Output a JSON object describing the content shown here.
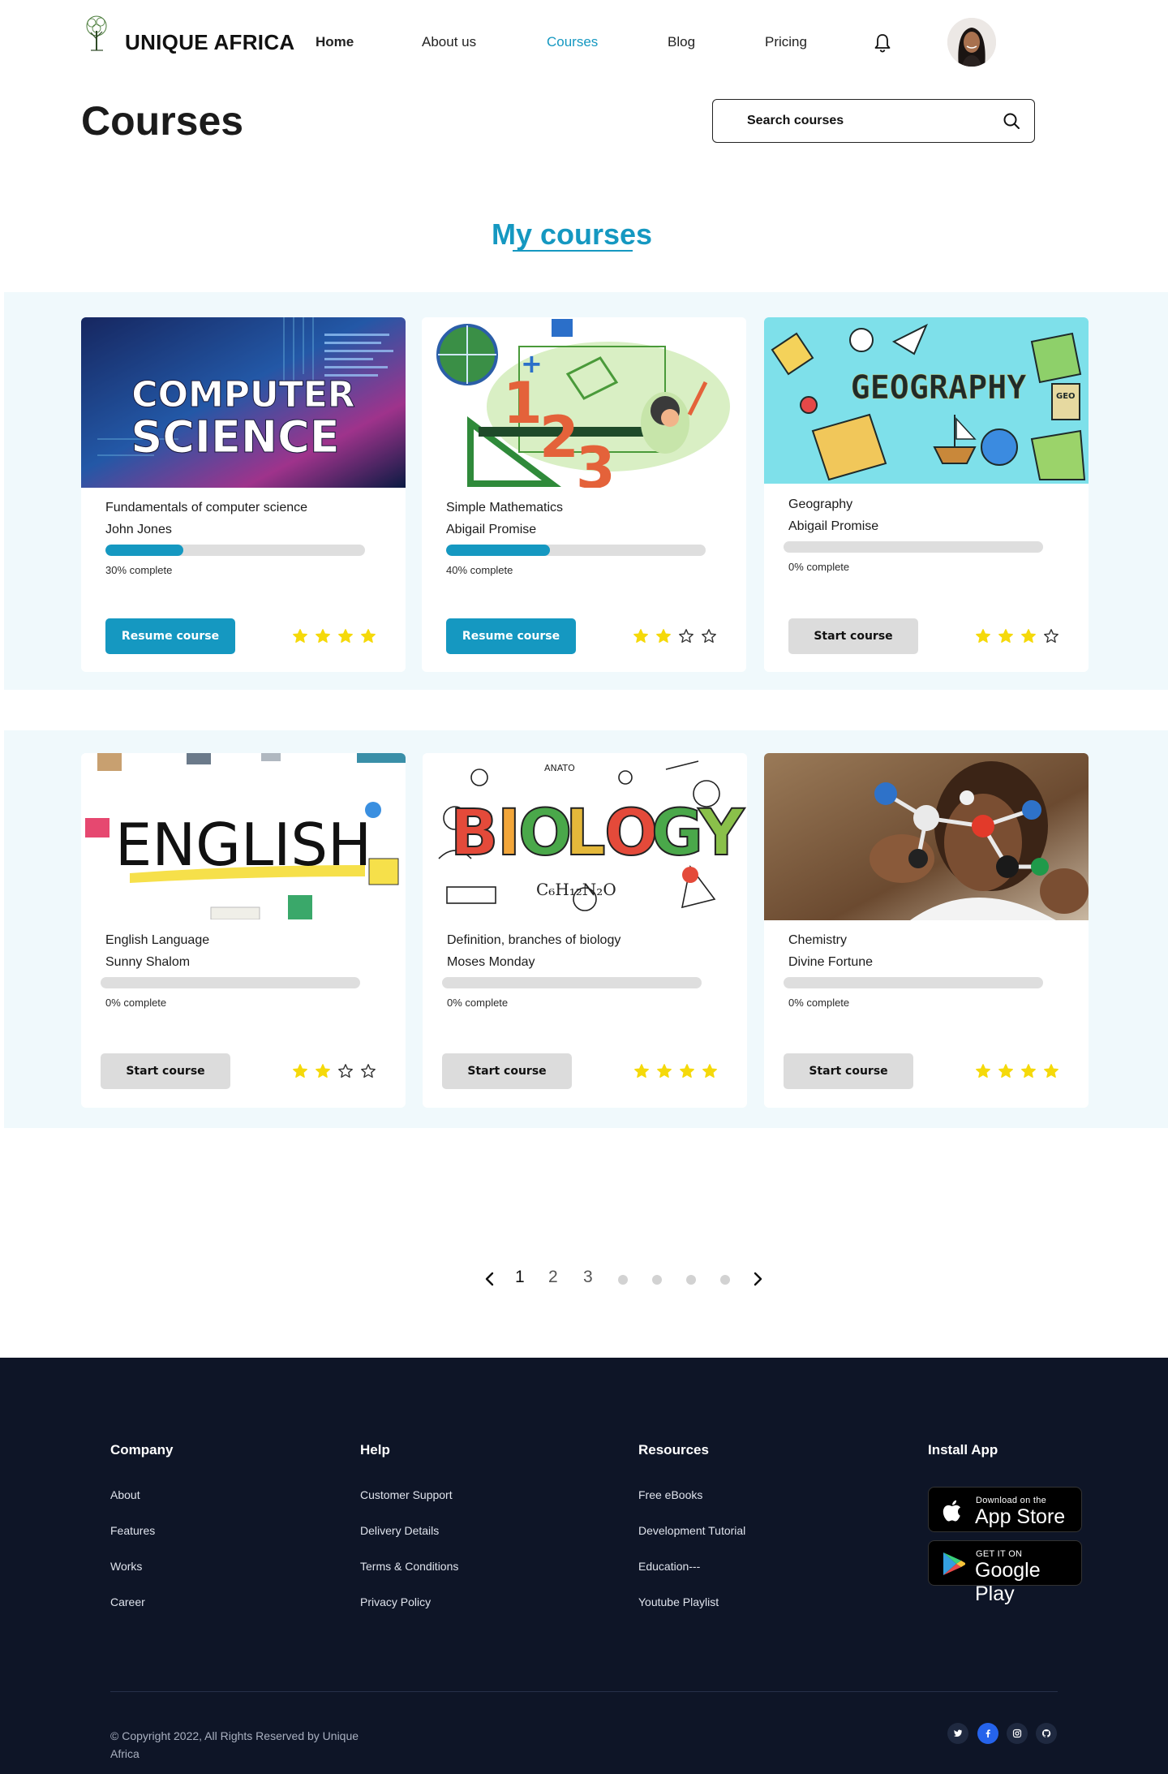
{
  "header": {
    "brand": "UNIQUE AFRICA",
    "nav": [
      {
        "label": "Home"
      },
      {
        "label": "About us"
      },
      {
        "label": "Courses"
      },
      {
        "label": "Blog"
      },
      {
        "label": "Pricing"
      }
    ],
    "active_nav": "Courses",
    "accent_color": "#1598c1"
  },
  "page": {
    "title": "Courses",
    "search_placeholder": "Search courses",
    "section_heading": "My courses"
  },
  "courses": [
    {
      "title": "Fundamentals of computer science",
      "author": "John Jones",
      "progress": 0.3,
      "progress_label": "30% complete",
      "button": "Resume course",
      "rating": 4,
      "image_text": [
        "COMPUTER",
        "SCIENCE"
      ]
    },
    {
      "title": "Simple Mathematics",
      "author": "Abigail Promise",
      "progress": 0.4,
      "progress_label": "40% complete",
      "button": "Resume course",
      "rating": 2,
      "image_text": [
        "1",
        "2",
        "3"
      ]
    },
    {
      "title": "Geography",
      "author": "Abigail Promise",
      "progress": 0,
      "progress_label": "0% complete",
      "button": "Start course",
      "rating": 3,
      "image_text": [
        "GEOGRAPHY",
        "GEO"
      ]
    },
    {
      "title": "English Language",
      "author": "Sunny Shalom",
      "progress": 0,
      "progress_label": "0% complete",
      "button": "Start course",
      "rating": 2,
      "image_text": [
        "ENGLISH"
      ]
    },
    {
      "title": "Definition, branches of biology",
      "author": "Moses Monday",
      "progress": 0,
      "progress_label": "0% complete",
      "button": "Start course",
      "rating": 4,
      "image_text": [
        "BIOLOGY",
        "ANATO",
        "C₆H₁₂N₂O"
      ]
    },
    {
      "title": "Chemistry",
      "author": "Divine Fortune",
      "progress": 0,
      "progress_label": "0% complete",
      "button": "Start course",
      "rating": 4,
      "image_text": []
    }
  ],
  "pagination": {
    "pages": [
      "1",
      "2",
      "3"
    ],
    "current": "1",
    "extra_dots": 4
  },
  "footer": {
    "columns": [
      {
        "title": "Company",
        "links": [
          "About",
          "Features",
          "Works",
          "Career"
        ]
      },
      {
        "title": "Help",
        "links": [
          "Customer Support",
          "Delivery Details",
          "Terms & Conditions",
          "Privacy Policy"
        ]
      },
      {
        "title": "Resources",
        "links": [
          "Free eBooks",
          "Development Tutorial",
          "Education---",
          "Youtube Playlist"
        ]
      }
    ],
    "install": {
      "title": "Install App",
      "app_store_small": "Download on the",
      "app_store_big": "App Store",
      "google_small": "GET IT ON",
      "google_big": "Google Play"
    },
    "copyright": "© Copyright 2022, All Rights Reserved by Unique Africa",
    "social": [
      "twitter-icon",
      "facebook-icon",
      "instagram-icon",
      "github-icon"
    ]
  }
}
